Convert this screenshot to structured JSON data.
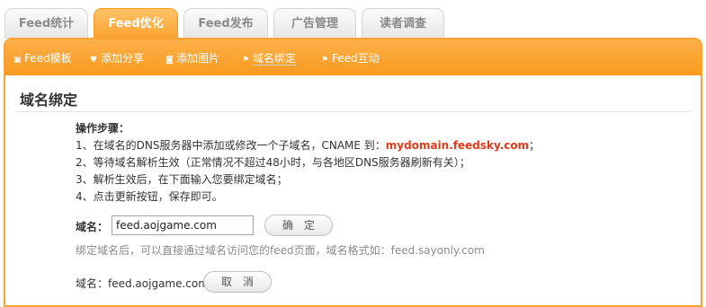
{
  "tabs": [
    {
      "label": "Feed统计",
      "active": false
    },
    {
      "label": "Feed优化",
      "active": true
    },
    {
      "label": "Feed发布",
      "active": false
    },
    {
      "label": "广告管理",
      "active": false
    },
    {
      "label": "读者调查",
      "active": false
    }
  ],
  "subnav": [
    {
      "label": "Feed模板",
      "icon": "template-icon"
    },
    {
      "label": "添加分享",
      "icon": "heart-icon"
    },
    {
      "label": "添加图片",
      "icon": "camera-icon"
    },
    {
      "label": "域名绑定",
      "icon": "flag-icon",
      "active": true
    },
    {
      "label": "Feed互动",
      "icon": "flag-icon"
    }
  ],
  "heading": "域名绑定",
  "steps": {
    "title": "操作步骤：",
    "step1_prefix": "1、在域名的DNS服务器中添加或修改一个子域名，CNAME 到：",
    "step1_highlight": "mydomain.feedsky.com",
    "step1_suffix": "；",
    "step2": "2、等待域名解析生效（正常情况不超过48小时，与各地区DNS服务器刷新有关）；",
    "step3": "3、解析生效后，在下面输入您要绑定域名；",
    "step4": "4、点击更新按钮，保存即可。"
  },
  "form": {
    "domain_label": "域名：",
    "domain_value": "feed.aojgame.com",
    "confirm_label": "确　定",
    "hint": "绑定域名后，可以直接通过域名访问您的feed页面，域名格式如：feed.sayonly.com"
  },
  "current": {
    "text": "域名：feed.aojgame.com",
    "cancel_label": "取　消"
  },
  "colors": {
    "accent": "#f8a232",
    "highlight": "#e23a1d"
  }
}
